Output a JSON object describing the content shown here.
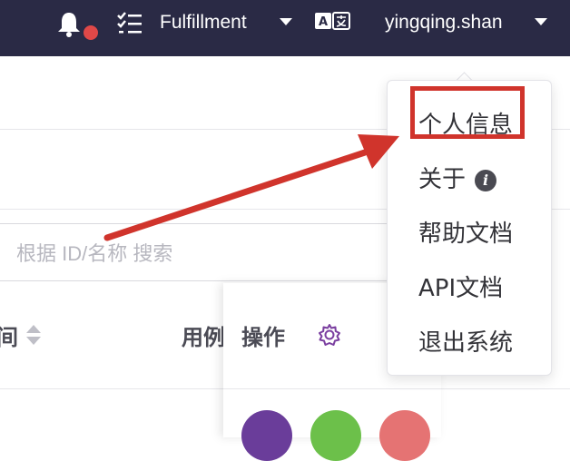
{
  "topbar": {
    "workspace_label": "Fulfillment",
    "username": "yingqing.shan",
    "icons": [
      "bell-icon",
      "task-list-icon",
      "translate-icon"
    ],
    "colors": {
      "background": "#2a2a45",
      "notification_dot": "#e04848"
    }
  },
  "search": {
    "placeholder": "根据 ID/名称 搜索"
  },
  "table": {
    "columns": [
      "间",
      "用例",
      "操作"
    ],
    "settings_icon": "gear-icon"
  },
  "user_menu": {
    "items": [
      {
        "label": "个人信息",
        "highlighted": true
      },
      {
        "label": "关于",
        "icon": "info-icon"
      },
      {
        "label": "帮助文档"
      },
      {
        "label": "API文档"
      },
      {
        "label": "退出系统"
      }
    ],
    "annotation_color": "#d0342c"
  },
  "action_buttons": {
    "colors": [
      "#6a3d9a",
      "#6cc04a",
      "#e57373"
    ]
  }
}
